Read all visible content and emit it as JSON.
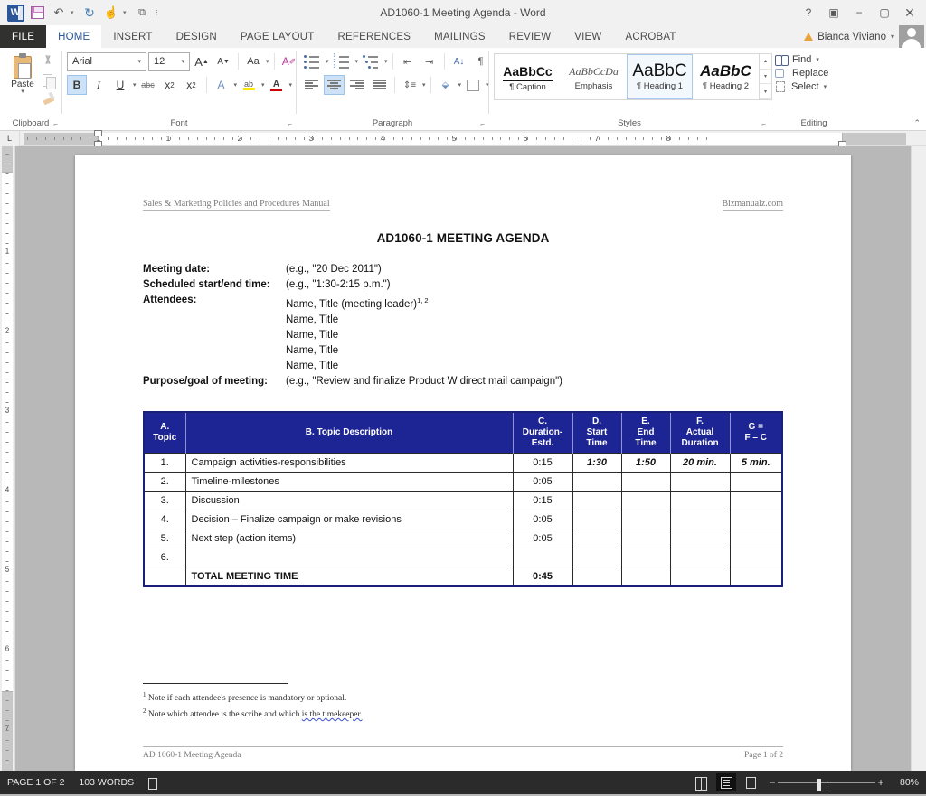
{
  "window": {
    "title": "AD1060-1 Meeting Agenda - Word",
    "quick_access": [
      "word-logo",
      "save-icon",
      "undo-icon",
      "redo-icon",
      "touch-mode-icon",
      "print-preview-icon",
      "customize-qat-icon"
    ],
    "controls": {
      "help": "?",
      "ribbon_display": "▣",
      "minimize": "−",
      "restore": "▢",
      "close": "✕"
    },
    "account_name": "Bianca Viviano",
    "account_caret": "▾"
  },
  "ribbon": {
    "tabs": [
      {
        "label": "FILE",
        "kind": "file"
      },
      {
        "label": "HOME",
        "kind": "active"
      },
      {
        "label": "INSERT",
        "kind": "normal"
      },
      {
        "label": "DESIGN",
        "kind": "normal"
      },
      {
        "label": "PAGE LAYOUT",
        "kind": "normal"
      },
      {
        "label": "REFERENCES",
        "kind": "normal"
      },
      {
        "label": "MAILINGS",
        "kind": "normal"
      },
      {
        "label": "REVIEW",
        "kind": "normal"
      },
      {
        "label": "VIEW",
        "kind": "normal"
      },
      {
        "label": "ACROBAT",
        "kind": "normal"
      }
    ],
    "groups": {
      "clipboard": {
        "label": "Clipboard",
        "paste_label": "Paste",
        "paste_caret": "▾",
        "cut": "Cut",
        "copy": "Copy",
        "format_painter": "Format Painter",
        "launcher": "⌐"
      },
      "font": {
        "label": "Font",
        "font_name": "Arial",
        "font_size": "12",
        "caret": "▾",
        "grow_font": "A",
        "shrink_font": "A",
        "change_case": "Aa",
        "clear_formatting": "A",
        "bold": "B",
        "italic": "I",
        "underline": "U",
        "strikethrough": "abc",
        "subscript_base": "x",
        "subscript_sub": "2",
        "superscript_base": "x",
        "superscript_sup": "2",
        "text_effects": "A",
        "highlight": "ab",
        "font_color": "A",
        "launcher": "⌐"
      },
      "paragraph": {
        "label": "Paragraph",
        "bullets": "Bullets",
        "numbering": "Numbering",
        "multilevel": "Multilevel List",
        "decrease_indent": "Decrease Indent",
        "increase_indent": "Increase Indent",
        "sort": "A↓",
        "show_marks": "¶",
        "align_left": "Align Left",
        "align_center": "Center",
        "align_right": "Align Right",
        "justify": "Justify",
        "line_spacing": "Line Spacing",
        "shading": "Shading",
        "borders": "Borders",
        "caret": "▾",
        "launcher": "⌐"
      },
      "styles": {
        "label": "Styles",
        "items": [
          {
            "preview": "AaBbCc",
            "name": "¶ Caption",
            "selected": false,
            "style": "caption"
          },
          {
            "preview": "AaBbCcDa",
            "name": "Emphasis",
            "selected": false,
            "style": "emph"
          },
          {
            "preview": "AaBbC",
            "name": "¶ Heading 1",
            "selected": true,
            "style": "h1"
          },
          {
            "preview": "AaBbC",
            "name": "¶ Heading 2",
            "selected": false,
            "style": "h2"
          }
        ],
        "scroll_up": "▴",
        "scroll_down": "▾",
        "more": "▾",
        "launcher": "⌐"
      },
      "editing": {
        "label": "Editing",
        "find": "Find",
        "replace": "Replace",
        "select": "Select",
        "caret": "▾"
      }
    },
    "collapse": "⌃"
  },
  "ruler": {
    "tabstop_marker": "L",
    "h_numbers": [
      "1",
      "1",
      "2",
      "3",
      "4",
      "5",
      "6",
      "7",
      "8"
    ],
    "v_numbers": [
      "1",
      "2",
      "3",
      "4",
      "5",
      "6",
      "7"
    ]
  },
  "document": {
    "header_left": "Sales & Marketing Policies and Procedures Manual",
    "header_right": "Bizmanualz.com",
    "title": "AD1060-1 MEETING AGENDA",
    "meta": [
      {
        "label": "Meeting date:",
        "value": "(e.g., \"20 Dec 2011\")",
        "sup": ""
      },
      {
        "label": "Scheduled start/end time:",
        "value": "(e.g., \"1:30-2:15 p.m.\")",
        "sup": ""
      },
      {
        "label": "Attendees:",
        "value": "Name, Title (meeting leader)",
        "sup": "1, 2"
      },
      {
        "label": "",
        "value": "Name, Title",
        "sup": ""
      },
      {
        "label": "",
        "value": "Name, Title",
        "sup": ""
      },
      {
        "label": "",
        "value": "Name, Title",
        "sup": ""
      },
      {
        "label": "",
        "value": "Name, Title",
        "sup": ""
      },
      {
        "label": "Purpose/goal of meeting:",
        "value": "(e.g., \"Review and finalize Product W direct mail campaign\")",
        "sup": ""
      }
    ],
    "table": {
      "headers": [
        "A.\nTopic",
        "B. Topic Description",
        "C.\nDuration-\nEstd.",
        "D.\nStart\nTime",
        "E.\nEnd\nTime",
        "F.\nActual\nDuration",
        "G =\nF – C"
      ],
      "rows": [
        {
          "topic": "1.",
          "description": "Campaign activities-responsibilities",
          "duration": "0:15",
          "start": "1:30",
          "end": "1:50",
          "actual": "20 min.",
          "g": "5 min.",
          "highlight": true
        },
        {
          "topic": "2.",
          "description": "Timeline-milestones",
          "duration": "0:05",
          "start": "",
          "end": "",
          "actual": "",
          "g": "",
          "highlight": false
        },
        {
          "topic": "3.",
          "description": "Discussion",
          "duration": "0:15",
          "start": "",
          "end": "",
          "actual": "",
          "g": "",
          "highlight": false
        },
        {
          "topic": "4.",
          "description": "Decision – Finalize campaign or make revisions",
          "duration": "0:05",
          "start": "",
          "end": "",
          "actual": "",
          "g": "",
          "highlight": false
        },
        {
          "topic": "5.",
          "description": "Next step (action items)",
          "duration": "0:05",
          "start": "",
          "end": "",
          "actual": "",
          "g": "",
          "highlight": false
        },
        {
          "topic": "6.",
          "description": "",
          "duration": "",
          "start": "",
          "end": "",
          "actual": "",
          "g": "",
          "highlight": false
        }
      ],
      "total_label": "TOTAL MEETING TIME",
      "total_value": "0:45"
    },
    "footnotes": [
      {
        "marker": "1",
        "text": "Note if each attendee's presence is mandatory or optional.",
        "plain": "Note if each attendee's presence is mandatory or optional.",
        "squiggle": ""
      },
      {
        "marker": "2",
        "text": "Note which attendee is the scribe and which is the timekeeper.",
        "plain": "Note which attendee is the scribe and which ",
        "squiggle": "is the timekeeper."
      }
    ],
    "footer_left": "AD 1060-1 Meeting Agenda",
    "footer_right": "Page 1 of 2"
  },
  "statusbar": {
    "page_info": "PAGE 1 OF 2",
    "word_count": "103 WORDS",
    "proofing_icon": "proofing-errors-icon",
    "views": [
      {
        "name": "read-mode",
        "selected": false
      },
      {
        "name": "print-layout",
        "selected": true
      },
      {
        "name": "web-layout",
        "selected": false
      }
    ],
    "zoom_minus": "−",
    "zoom_plus": "+",
    "zoom_level": "80%"
  },
  "colors": {
    "table_header_bg": "#1d2494",
    "accent_blue": "#2b579a",
    "word_blue": "#2b579a",
    "statusbar_bg": "#2b2b2b",
    "blue_text": "#1d2494"
  }
}
